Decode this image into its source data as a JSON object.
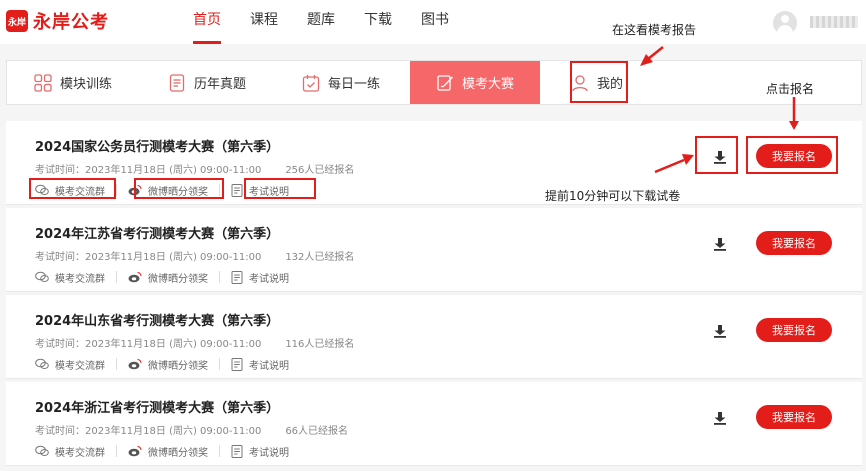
{
  "logo": {
    "badge": "永岸",
    "text": "永岸公考"
  },
  "nav": [
    "首页",
    "课程",
    "题库",
    "下载",
    "图书"
  ],
  "nav_active": 0,
  "tabs": [
    {
      "label": "模块训练",
      "icon": "grid-icon"
    },
    {
      "label": "历年真题",
      "icon": "document-icon"
    },
    {
      "label": "每日一练",
      "icon": "calendar-check-icon"
    },
    {
      "label": "模考大赛",
      "icon": "edit-paper-icon"
    },
    {
      "label": "我的",
      "icon": "user-icon"
    }
  ],
  "tab_active": 3,
  "cards": [
    {
      "title": "2024国家公务员行测模考大赛（第六季）",
      "exam_time": "考试时间：2023年11月18日 (周六) 09:00-11:00",
      "registered": "256人已经报名"
    },
    {
      "title": "2024年江苏省考行测模考大赛（第六季）",
      "exam_time": "考试时间：2023年11月18日 (周六) 09:00-11:00",
      "registered": "132人已经报名"
    },
    {
      "title": "2024年山东省考行测模考大赛（第六季）",
      "exam_time": "考试时间：2023年11月18日 (周六) 09:00-11:00",
      "registered": "116人已经报名"
    },
    {
      "title": "2024年浙江省考行测模考大赛（第六季）",
      "exam_time": "考试时间：2023年11月18日 (周六) 09:00-11:00",
      "registered": "66人已经报名"
    }
  ],
  "card_links": {
    "group": "模考交流群",
    "weibo": "微博晒分领奖",
    "notes": "考试说明"
  },
  "register_label": "我要报名",
  "annotations": {
    "report_note": "在这看模考报告",
    "register_note": "点击报名",
    "download_note": "提前10分钟可以下载试卷"
  },
  "colors": {
    "brand_red": "#e31d1a",
    "active_tab": "#f6676a"
  }
}
